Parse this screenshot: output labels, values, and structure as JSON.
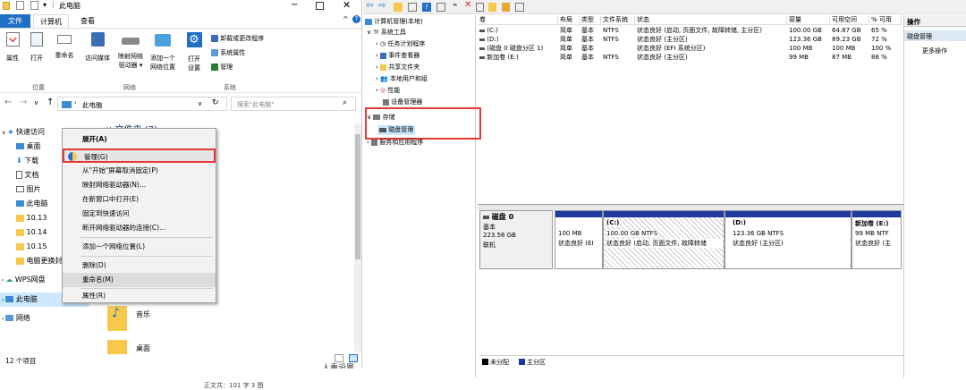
{
  "explorer": {
    "title": "此电脑",
    "tabs": [
      "文件",
      "计算机",
      "查看"
    ],
    "ribbon": {
      "properties": "属性",
      "open": "打开",
      "rename": "重命名",
      "access_media": "访问媒体",
      "map_drive_1": "映射网络",
      "map_drive_2": "驱动器 ▾",
      "add_location_1": "添加一个",
      "add_location_2": "网络位置",
      "open_settings_1": "打开",
      "open_settings_2": "设置",
      "uninstall": "卸载或更改程序",
      "sys_props": "系统属性",
      "manage": "管理",
      "group_location": "位置",
      "group_network": "网络",
      "group_system": "系统"
    },
    "address": "此电脑",
    "search_placeholder": "搜索\"此电脑\"",
    "folders_header": "文件夹 (7)",
    "nav": [
      "快速访问",
      "桌面",
      "下载",
      "文档",
      "图片",
      "此电脑",
      "10.13",
      "10.14",
      "10.15",
      "电脑更换封",
      "WPS网盘",
      "此电脑",
      "网络"
    ],
    "files": [
      "音乐",
      "桌面"
    ],
    "status": "12 个项目",
    "context_menu": [
      "展开(A)",
      "管理(G)",
      "从\"开始\"屏幕取消固定(P)",
      "映射网络驱动器(N)...",
      "在新窗口中打开(E)",
      "固定到快速访问",
      "断开网络驱动器的连接(C)...",
      "添加一个网络位置(L)",
      "删除(D)",
      "重命名(M)",
      "属性(R)"
    ]
  },
  "footer": {
    "wordcount": "正文共：101 字 3 图",
    "stray": "人重设置"
  },
  "mmc": {
    "tree": [
      "计算机管理(本地)",
      "系统工具",
      "任务计划程序",
      "事件查看器",
      "共享文件夹",
      "本地用户和组",
      "性能",
      "设备管理器",
      "存储",
      "磁盘管理",
      "服务和应用程序"
    ],
    "columns": [
      "卷",
      "布局",
      "类型",
      "文件系统",
      "状态",
      "容量",
      "可用空间",
      "% 可用"
    ],
    "rows": [
      [
        "(C:)",
        "简单",
        "基本",
        "NTFS",
        "状态良好 (启动, 页面文件, 故障转储, 主分区)",
        "100.00 GB",
        "64.87 GB",
        "65 %"
      ],
      [
        "(D:)",
        "简单",
        "基本",
        "NTFS",
        "状态良好 (主分区)",
        "123.36 GB",
        "89.23 GB",
        "72 %"
      ],
      [
        "(磁盘 0 磁盘分区 1)",
        "简单",
        "基本",
        "",
        "状态良好 (EFI 系统分区)",
        "100 MB",
        "100 MB",
        "100 %"
      ],
      [
        "新加卷 (E:)",
        "简单",
        "基本",
        "NTFS",
        "状态良好 (主分区)",
        "99 MB",
        "87 MB",
        "88 %"
      ]
    ],
    "disk": {
      "name": "磁盘 0",
      "type": "基本",
      "size": "223.56 GB",
      "state": "联机"
    },
    "partitions": [
      {
        "title": "",
        "size": "100 MB",
        "status": "状态良好 (EI"
      },
      {
        "title": "(C:)",
        "size": "100.00 GB NTFS",
        "status": "状态良好 (启动, 页面文件, 故障转储"
      },
      {
        "title": "(D:)",
        "size": "123.36 GB NTFS",
        "status": "状态良好 (主分区)"
      },
      {
        "title": "新加卷 (E:)",
        "size": "99 MB NTF",
        "status": "状态良好 (主"
      }
    ],
    "legend": [
      "未分配",
      "主分区"
    ],
    "actions": {
      "header": "操作",
      "section": "磁盘管理",
      "more": "更多操作"
    },
    "colors": {
      "primary": "#1c3a9e",
      "unallocated": "#000000",
      "highlight": "#e53935"
    }
  }
}
